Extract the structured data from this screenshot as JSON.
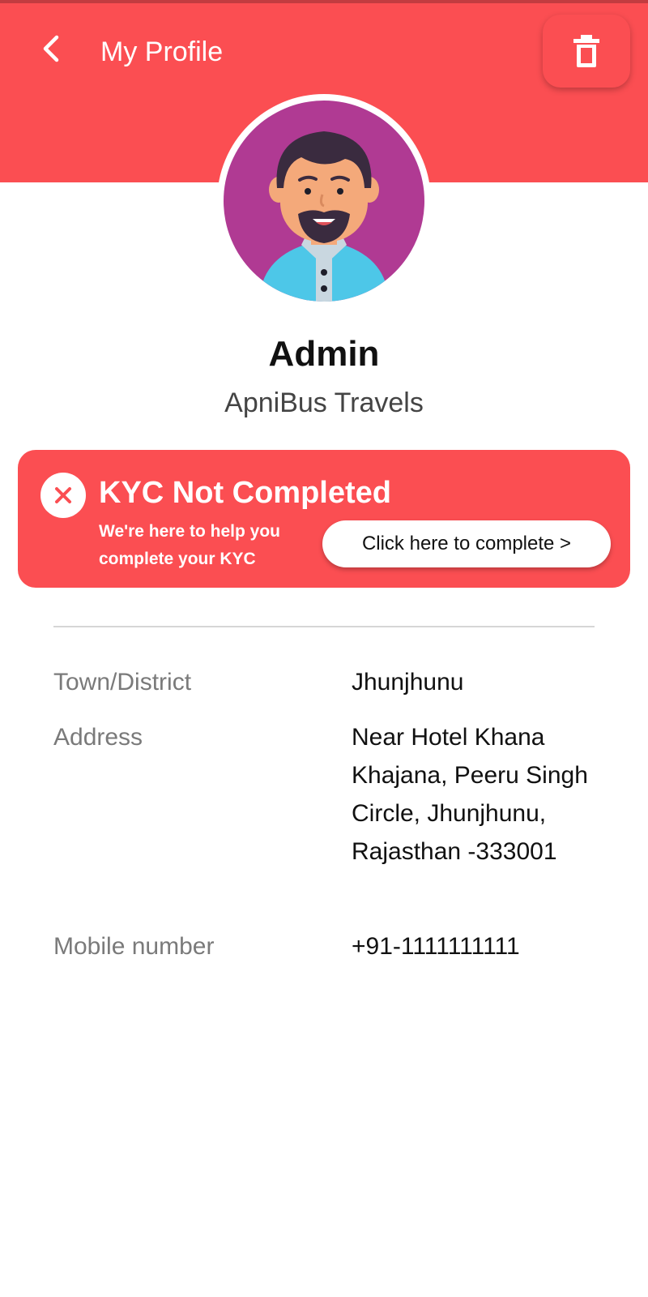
{
  "header": {
    "title": "My Profile",
    "back_icon": "chevron-left-icon",
    "delete_icon": "trash-icon",
    "color": "#fb4e52"
  },
  "profile": {
    "name": "Admin",
    "company": "ApniBus Travels",
    "avatar_bg": "#b03a93"
  },
  "kyc": {
    "status_icon": "close-circle-icon",
    "title": "KYC Not Completed",
    "subtitle": "We're here to help you complete your KYC",
    "action_label": "Click here to complete >",
    "color": "#fb4e52"
  },
  "details": [
    {
      "label": "Town/District",
      "value": "Jhunjhunu"
    },
    {
      "label": "Address",
      "value": "Near Hotel Khana Khajana, Peeru Singh Circle, Jhunjhunu, Rajasthan -333001"
    },
    {
      "label": "Mobile number",
      "value": "+91-1111111111"
    }
  ]
}
